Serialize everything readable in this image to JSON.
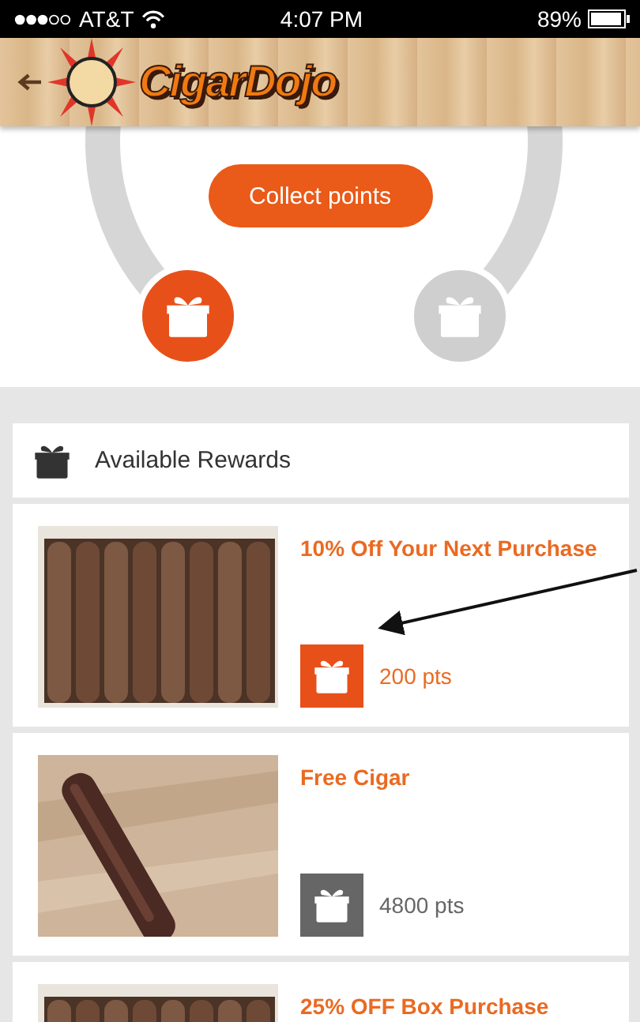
{
  "status_bar": {
    "carrier": "AT&T",
    "time": "4:07 PM",
    "battery": "89%"
  },
  "header": {
    "logo": "CigarDojo"
  },
  "points": {
    "button": "Collect points",
    "milestones": [
      {
        "reached": true
      },
      {
        "reached": false
      }
    ]
  },
  "rewards": {
    "title": "Available Rewards",
    "items": [
      {
        "title": "10% Off Your Next Purchase",
        "points": "200 pts",
        "available": true
      },
      {
        "title": "Free Cigar",
        "points": "4800 pts",
        "available": false
      },
      {
        "title": "25% OFF Box Purchase"
      }
    ]
  }
}
